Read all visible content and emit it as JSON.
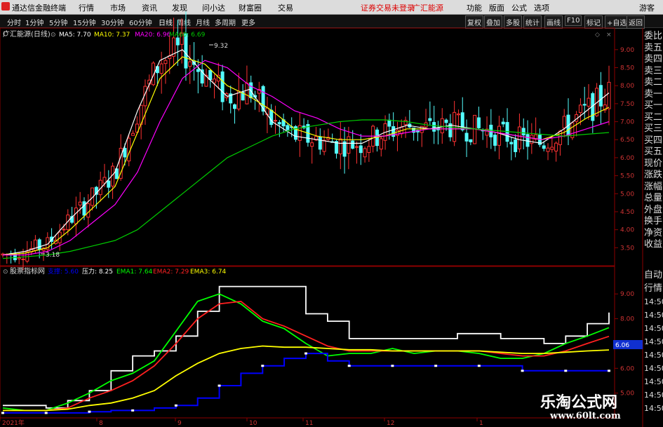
{
  "menubar": {
    "app_name": "通达信金融终端",
    "menus": [
      "行情",
      "市场",
      "资讯",
      "发现",
      "问小达",
      "财富圈",
      "交易"
    ],
    "status": "证券交易未登录",
    "stock_name": "广汇能源",
    "right_menus": [
      "功能",
      "版面",
      "公式",
      "选项"
    ],
    "user": "游客"
  },
  "toolbar": {
    "periods": [
      "分时",
      "1分钟",
      "5分钟",
      "15分钟",
      "30分钟",
      "60分钟",
      "日线",
      "周线",
      "月线",
      "多周期",
      "更多"
    ],
    "active_period": "日线",
    "buttons": [
      "复权",
      "叠加",
      "多股",
      "统计",
      "画线",
      "F10",
      "标记",
      "+自选",
      "返回"
    ]
  },
  "main_chart": {
    "title": "广汇能源(日线)",
    "ma5_label": "MA5: 7.70",
    "ma10_label": "MA10: 7.37",
    "ma20_label": "MA20: 6.96",
    "ma60_label": "MA60: 6.69",
    "high_label": "9.32",
    "low_label": "3.18",
    "y_ticks": [
      "9.00",
      "8.50",
      "8.00",
      "7.50",
      "7.00",
      "6.50",
      "6.00",
      "5.50",
      "5.00",
      "4.50",
      "4.00",
      "3.50"
    ]
  },
  "sub_chart": {
    "title": "股票指标网",
    "blue_label": "支撑: 5.60",
    "press_label": "压力: 8.25",
    "ema1_label": "EMA1: 7.64",
    "ema2_label": "EMA2: 7.29",
    "ema3_label": "EMA3: 6.74",
    "y_ticks": [
      "9.00",
      "8.00",
      "7.00",
      "6.00",
      "5.00"
    ],
    "price_box": "6.06"
  },
  "x_axis": {
    "labels": [
      "2021年",
      "8",
      "9",
      "10",
      "11",
      "12",
      "1"
    ]
  },
  "sidebar_top": [
    "委比",
    "卖五",
    "卖四",
    "卖三",
    "卖二",
    "卖一",
    "买一",
    "买二",
    "买三",
    "买四",
    "买五",
    "现价",
    "涨跌",
    "涨幅",
    "总量",
    "外盘",
    "换手",
    "净资",
    "收益"
  ],
  "sidebar_bottom": [
    "自动",
    "行情",
    "14:50",
    "14:50",
    "14:50",
    "14:50",
    "14:50",
    "14:50",
    "14:50",
    "14:50",
    "14:50"
  ],
  "watermark": {
    "cn": "乐淘公式网",
    "url": "www.60lt.com"
  },
  "colors": {
    "up": "#ff3232",
    "down": "#54ffff",
    "ma5": "#ffffff",
    "ma10": "#ffff00",
    "ma20": "#ff00ff",
    "ma60": "#00cc00",
    "press": "#ffffff",
    "ema1": "#00ff00",
    "ema2": "#ff2020",
    "ema3": "#ffff00",
    "support": "#0000ff"
  },
  "chart_data": [
    {
      "type": "line",
      "title": "广汇能源(日线)",
      "xlabel": "",
      "ylabel": "",
      "x": [
        "2021年",
        "8",
        "9",
        "10",
        "11",
        "12",
        "1"
      ],
      "ylim": [
        3.0,
        9.6
      ],
      "series": [
        {
          "name": "MA5",
          "values": [
            3.3,
            3.4,
            3.6,
            4.3,
            4.9,
            5.6,
            7.3,
            8.7,
            9.0,
            8.3,
            7.7,
            7.9,
            7.0,
            6.6,
            6.5,
            6.4,
            6.4,
            6.7,
            6.9,
            6.8,
            6.9,
            6.8,
            6.7,
            6.5,
            6.4,
            6.8,
            7.3,
            7.8
          ]
        },
        {
          "name": "MA10",
          "values": [
            3.3,
            3.35,
            3.5,
            4.0,
            4.6,
            5.2,
            6.7,
            8.2,
            8.8,
            8.6,
            8.0,
            7.7,
            7.3,
            6.8,
            6.6,
            6.5,
            6.5,
            6.6,
            6.8,
            6.8,
            6.8,
            6.8,
            6.7,
            6.6,
            6.5,
            6.7,
            7.1,
            7.4
          ]
        },
        {
          "name": "MA20",
          "values": [
            3.3,
            3.3,
            3.4,
            3.7,
            4.2,
            4.7,
            5.6,
            7.0,
            8.2,
            8.7,
            8.5,
            8.0,
            7.7,
            7.3,
            7.1,
            6.8,
            6.6,
            6.6,
            6.7,
            6.8,
            6.8,
            6.8,
            6.7,
            6.6,
            6.5,
            6.6,
            6.8,
            7.0
          ]
        },
        {
          "name": "MA60",
          "values": [
            3.2,
            3.25,
            3.3,
            3.4,
            3.55,
            3.7,
            4.0,
            4.5,
            5.0,
            5.5,
            6.0,
            6.3,
            6.6,
            6.8,
            6.9,
            7.0,
            7.05,
            7.05,
            7.0,
            6.9,
            6.85,
            6.8,
            6.75,
            6.7,
            6.65,
            6.6,
            6.65,
            6.7
          ]
        }
      ]
    },
    {
      "type": "line",
      "title": "股票指标网",
      "xlabel": "",
      "ylabel": "",
      "x": [
        "2021年",
        "8",
        "9",
        "10",
        "11",
        "12",
        "1"
      ],
      "ylim": [
        4.0,
        9.6
      ],
      "series": [
        {
          "name": "压力",
          "values": [
            4.5,
            4.5,
            4.4,
            4.7,
            5.1,
            5.9,
            6.5,
            6.7,
            7.3,
            8.3,
            9.3,
            9.3,
            9.3,
            9.3,
            8.2,
            7.9,
            7.2,
            7.2,
            7.2,
            7.2,
            7.2,
            7.4,
            7.4,
            7.2,
            7.2,
            7.0,
            7.3,
            7.8,
            8.25
          ]
        },
        {
          "name": "EMA1",
          "values": [
            4.4,
            4.3,
            4.3,
            4.6,
            5.0,
            5.5,
            5.8,
            6.3,
            7.5,
            8.7,
            9.0,
            8.6,
            7.9,
            7.6,
            7.0,
            6.5,
            6.6,
            6.6,
            6.8,
            6.6,
            6.7,
            6.7,
            6.6,
            6.4,
            6.4,
            6.6,
            7.0,
            7.3,
            7.64
          ]
        },
        {
          "name": "EMA2",
          "values": [
            4.3,
            4.3,
            4.3,
            4.4,
            4.8,
            5.1,
            5.5,
            6.1,
            7.0,
            8.0,
            8.6,
            8.7,
            8.0,
            7.7,
            7.3,
            6.9,
            6.7,
            6.7,
            6.7,
            6.7,
            6.7,
            6.7,
            6.7,
            6.6,
            6.5,
            6.5,
            6.7,
            7.0,
            7.29
          ]
        },
        {
          "name": "EMA3",
          "values": [
            4.3,
            4.3,
            4.3,
            4.35,
            4.5,
            4.6,
            4.8,
            5.1,
            5.7,
            6.2,
            6.6,
            6.8,
            6.9,
            6.85,
            6.85,
            6.8,
            6.75,
            6.75,
            6.7,
            6.7,
            6.7,
            6.7,
            6.7,
            6.65,
            6.6,
            6.6,
            6.65,
            6.7,
            6.74
          ]
        },
        {
          "name": "支撑",
          "values": [
            4.2,
            4.2,
            4.2,
            4.2,
            4.25,
            4.3,
            4.3,
            4.4,
            4.5,
            4.8,
            5.3,
            5.8,
            6.1,
            6.4,
            6.6,
            6.3,
            6.1,
            6.1,
            6.1,
            6.1,
            6.1,
            6.1,
            6.1,
            6.1,
            5.9,
            5.9,
            5.9,
            5.9,
            5.9
          ]
        }
      ]
    }
  ]
}
